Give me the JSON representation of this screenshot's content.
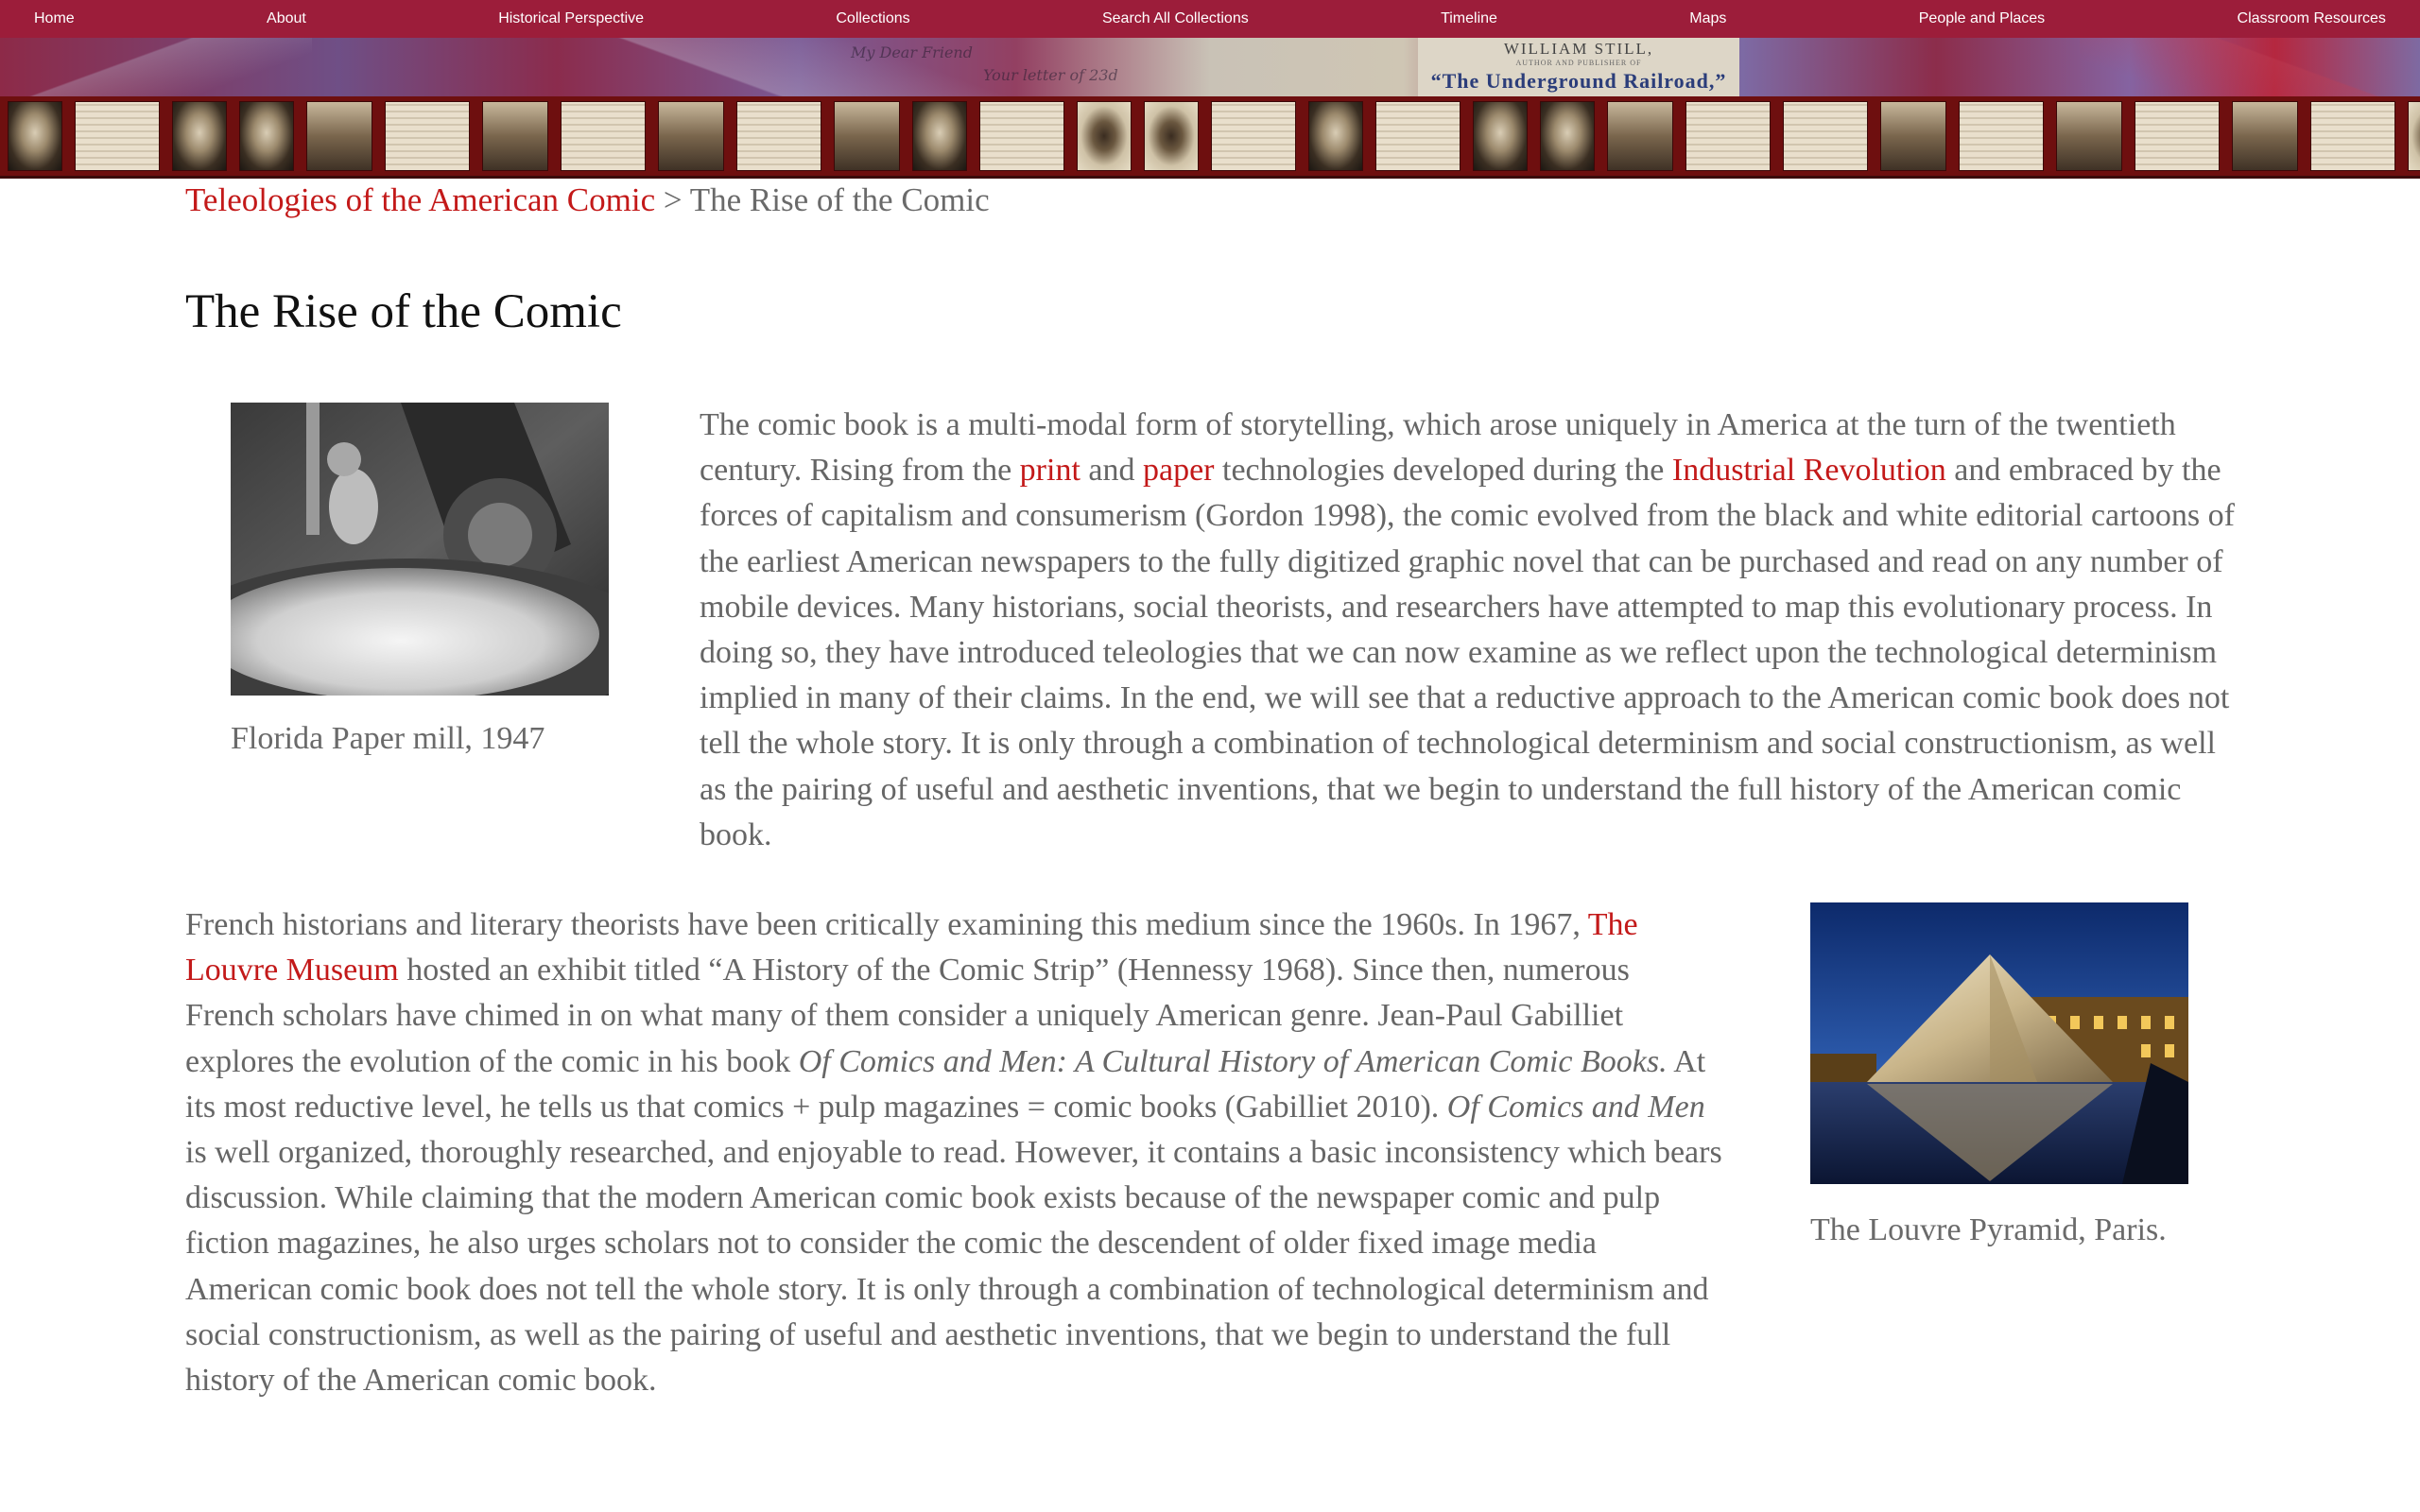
{
  "nav": {
    "items": [
      "Home",
      "About",
      "Historical Perspective",
      "Collections",
      "Search All Collections",
      "Timeline",
      "Maps",
      "People and Places",
      "Classroom Resources"
    ]
  },
  "banner": {
    "line1": "WILLIAM STILL,",
    "line2": "AUTHOR AND PUBLISHER OF",
    "line3": "“The Underground Railroad,”",
    "script1": "My Dear Friend",
    "script2": "Your letter of 23d"
  },
  "breadcrumb": {
    "parent": "Teleologies of the American Comic",
    "separator": ">",
    "current": "The Rise of the Comic"
  },
  "page_title": "The Rise of the Comic",
  "figure1": {
    "caption": "Florida Paper mill, 1947",
    "icon": "paper-mill-photo"
  },
  "figure2": {
    "caption": "The Louvre Pyramid, Paris.",
    "icon": "louvre-pyramid-photo"
  },
  "para1": {
    "t1": "The comic book is a multi-modal form of storytelling, which arose uniquely in America at the turn of the twentieth century. Rising from the ",
    "link_print": "print",
    "t2": " and ",
    "link_paper": "paper",
    "t3": " technologies developed during the ",
    "link_industrial": "Industrial Revolution",
    "t4": " and embraced by the forces of capitalism and consumerism (Gordon 1998), the comic evolved from the black and white editorial cartoons of the earliest American newspapers to the fully digitized graphic novel that can be purchased and read on any number of mobile devices. Many historians, social theorists, and researchers have attempted to map this evolutionary process. In doing so, they have introduced teleologies that we can now examine as we reflect upon the technological determinism implied in many of their claims. In the end, we will see that a reductive approach to the American comic book does not tell the whole story. It is only through a combination of technological determinism and social constructionism, as well as the pairing of useful and aesthetic inventions, that we begin to understand the full history of the American comic book."
  },
  "para2": {
    "t1": "French historians and literary theorists have been critically examining this medium since the 1960s. In 1967, ",
    "link_louvre": "The Louvre Museum",
    "t2": " hosted an exhibit titled “A History of the Comic Strip” (Hennessy 1968). Since then, numerous French scholars have chimed in on what many of them consider a uniquely American genre. Jean-Paul Gabilliet explores the evolution of the comic in his book ",
    "book1": "Of Comics and Men: A Cultural History of American Comic Books.",
    "t3": " At its most reductive level, he tells us that comics + pulp magazines = comic books (Gabilliet 2010). ",
    "book2": "Of Comics and Men",
    "t4": " is well organized, thoroughly researched, and enjoyable to read. However, it contains a basic inconsistency which bears discussion. While claiming that the modern American comic book exists because of the newspaper comic and pulp fiction magazines, he also urges scholars not to consider the comic the descendent of older fixed image media American comic book does not tell the whole story. It is only through a combination of technological determinism and social constructionism, as well as the pairing of useful and aesthetic inventions, that we begin to understand the full history of the American comic book."
  },
  "colors": {
    "nav": "#9c1d3a",
    "link": "#c31919",
    "thumb_strip": "#6e0f0f"
  }
}
